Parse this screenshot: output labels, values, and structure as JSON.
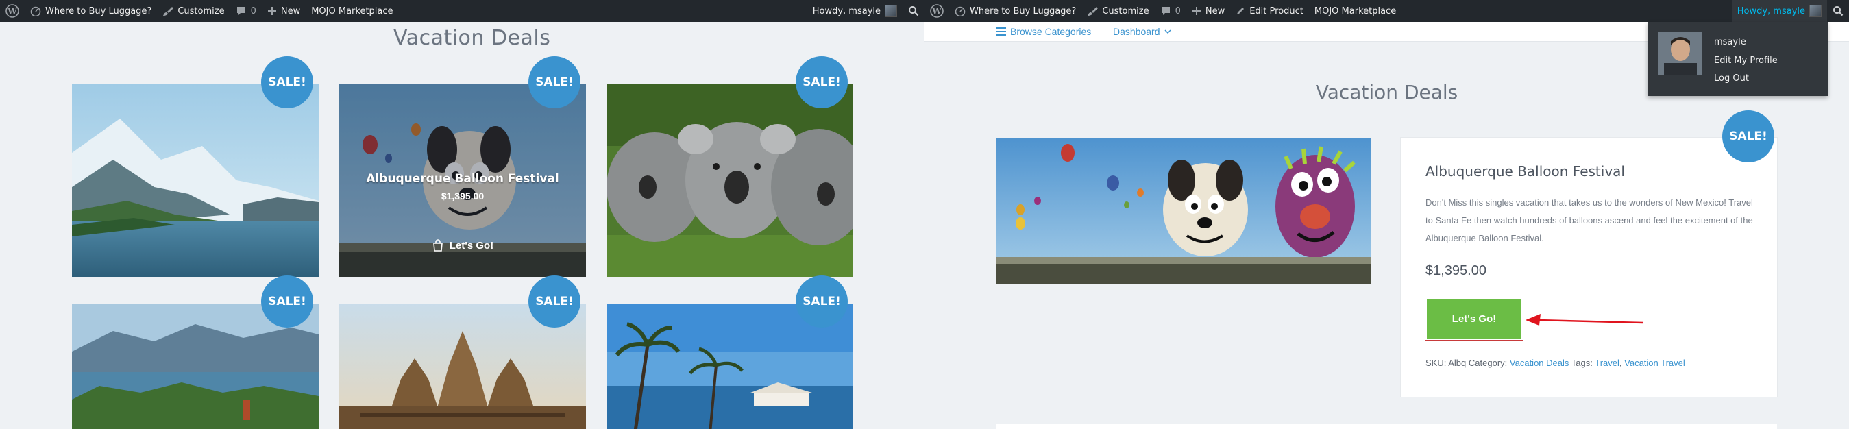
{
  "admin_bar": {
    "left": {
      "site_name": "Where to Buy Luggage?",
      "customize": "Customize",
      "comments_count": "0",
      "new_label": "New",
      "marketplace": "MOJO Marketplace",
      "howdy": "Howdy, msayle"
    },
    "right": {
      "site_name": "Where to Buy Luggage?",
      "customize": "Customize",
      "comments_count": "0",
      "new_label": "New",
      "edit_product": "Edit Product",
      "marketplace": "MOJO Marketplace",
      "howdy": "Howdy, msayle"
    }
  },
  "left_panel": {
    "section_title": "Vacation Deals",
    "sale_badge": "SALE!",
    "hover_card": {
      "title": "Albuquerque Balloon Festival",
      "price": "$1,395.00",
      "button": "Let's Go!"
    }
  },
  "right_panel": {
    "subnav": {
      "browse": "Browse Categories",
      "dashboard": "Dashboard"
    },
    "section_title": "Vacation Deals",
    "sale_badge": "SALE!",
    "product": {
      "title": "Albuquerque Balloon Festival",
      "description": "Don't Miss this singles vacation that takes us to the wonders of New Mexico! Travel to Santa Fe then watch hundreds of balloons ascend and feel the excitement of the Albuquerque Balloon Festival.",
      "price": "$1,395.00",
      "button": "Let's Go!",
      "sku_label": "SKU:",
      "sku_value": "Albq",
      "category_label": "Category:",
      "category_value": "Vacation Deals",
      "tags_label": "Tags:",
      "tag_1": "Travel",
      "tag_sep": ",",
      "tag_2": "Vacation Travel"
    },
    "user_dropdown": {
      "username": "msayle",
      "edit_profile": "Edit My Profile",
      "logout": "Log Out"
    }
  },
  "colors": {
    "admin_bar": "#23282d",
    "sale_badge": "#3a93cf",
    "accent_link": "#3a93cf",
    "cta_green": "#6bbd45",
    "annotation_red": "#e0141e"
  }
}
